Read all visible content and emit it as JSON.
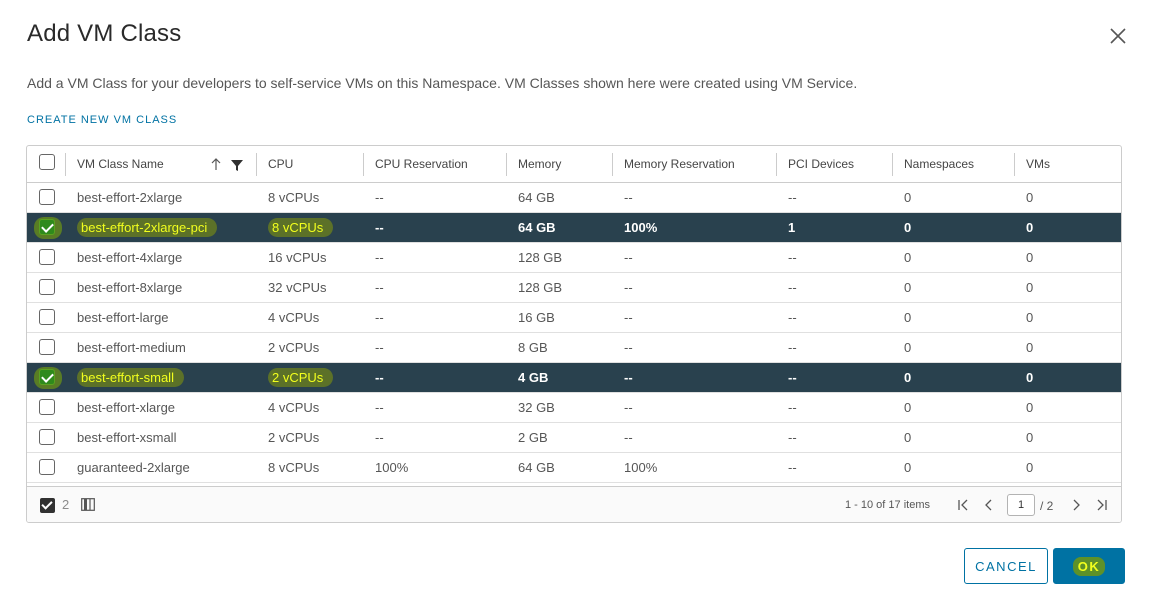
{
  "dialog": {
    "title": "Add VM Class",
    "description": "Add a VM Class for your developers to self-service VMs on this Namespace. VM Classes shown here were created using VM Service.",
    "create_link": "CREATE NEW VM CLASS"
  },
  "table": {
    "columns": [
      "VM Class Name",
      "CPU",
      "CPU Reservation",
      "Memory",
      "Memory Reservation",
      "PCI Devices",
      "Namespaces",
      "VMs"
    ],
    "rows": [
      {
        "name": "best-effort-2xlarge",
        "cpu": "8 vCPUs",
        "cpu_res": "--",
        "memory": "64 GB",
        "mem_res": "--",
        "pci": "--",
        "namespaces": "0",
        "vms": "0",
        "selected": false
      },
      {
        "name": "best-effort-2xlarge-pci",
        "cpu": "8 vCPUs",
        "cpu_res": "--",
        "memory": "64 GB",
        "mem_res": "100%",
        "pci": "1",
        "namespaces": "0",
        "vms": "0",
        "selected": true
      },
      {
        "name": "best-effort-4xlarge",
        "cpu": "16 vCPUs",
        "cpu_res": "--",
        "memory": "128 GB",
        "mem_res": "--",
        "pci": "--",
        "namespaces": "0",
        "vms": "0",
        "selected": false
      },
      {
        "name": "best-effort-8xlarge",
        "cpu": "32 vCPUs",
        "cpu_res": "--",
        "memory": "128 GB",
        "mem_res": "--",
        "pci": "--",
        "namespaces": "0",
        "vms": "0",
        "selected": false
      },
      {
        "name": "best-effort-large",
        "cpu": "4 vCPUs",
        "cpu_res": "--",
        "memory": "16 GB",
        "mem_res": "--",
        "pci": "--",
        "namespaces": "0",
        "vms": "0",
        "selected": false
      },
      {
        "name": "best-effort-medium",
        "cpu": "2 vCPUs",
        "cpu_res": "--",
        "memory": "8 GB",
        "mem_res": "--",
        "pci": "--",
        "namespaces": "0",
        "vms": "0",
        "selected": false
      },
      {
        "name": "best-effort-small",
        "cpu": "2 vCPUs",
        "cpu_res": "--",
        "memory": "4 GB",
        "mem_res": "--",
        "pci": "--",
        "namespaces": "0",
        "vms": "0",
        "selected": true
      },
      {
        "name": "best-effort-xlarge",
        "cpu": "4 vCPUs",
        "cpu_res": "--",
        "memory": "32 GB",
        "mem_res": "--",
        "pci": "--",
        "namespaces": "0",
        "vms": "0",
        "selected": false
      },
      {
        "name": "best-effort-xsmall",
        "cpu": "2 vCPUs",
        "cpu_res": "--",
        "memory": "2 GB",
        "mem_res": "--",
        "pci": "--",
        "namespaces": "0",
        "vms": "0",
        "selected": false
      },
      {
        "name": "guaranteed-2xlarge",
        "cpu": "8 vCPUs",
        "cpu_res": "100%",
        "memory": "64 GB",
        "mem_res": "100%",
        "pci": "--",
        "namespaces": "0",
        "vms": "0",
        "selected": false
      }
    ]
  },
  "footer": {
    "selected_count": "2",
    "items_info": "1 - 10 of 17 items",
    "page_current": "1",
    "page_total": "/ 2"
  },
  "buttons": {
    "cancel": "CANCEL",
    "ok": "OK"
  },
  "colors": {
    "accent": "#0072a3",
    "selected_row": "#29414e",
    "highlight_text": "#f2ff1e"
  },
  "icons": [
    "close-icon",
    "sort-ascending-icon",
    "filter-icon",
    "column-toggle-icon",
    "first-page-icon",
    "prev-page-icon",
    "next-page-icon",
    "last-page-icon"
  ]
}
